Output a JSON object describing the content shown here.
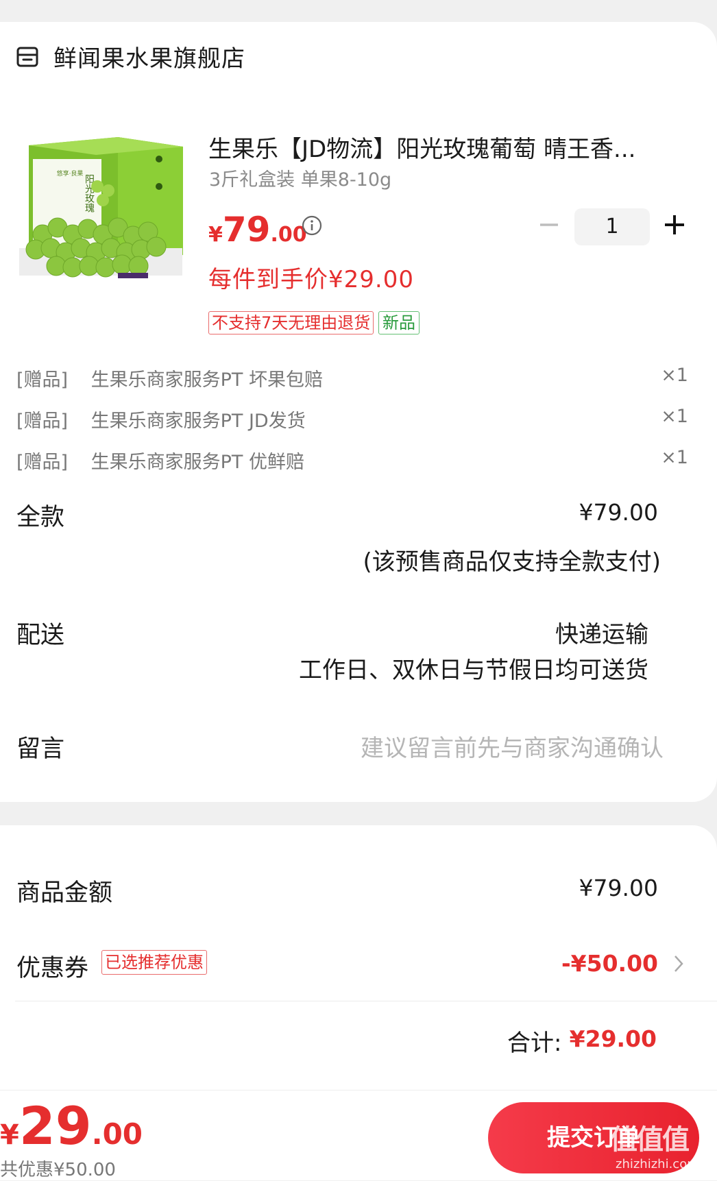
{
  "store": {
    "icon": "store-icon",
    "name": "鲜闻果水果旗舰店"
  },
  "product": {
    "title": "生果乐【JD物流】阳光玫瑰葡萄 晴王香...",
    "spec": "3斤礼盒装 单果8-10g",
    "price_yen": "¥",
    "price_int": "79",
    "price_dec": ".00",
    "arrive_price": "每件到手价¥29.00",
    "quantity": "1",
    "tags": [
      "不支持7天无理由退货",
      "新品"
    ],
    "image_box_text": "阳光玫瑰",
    "image_brand_text": "悠享·良果"
  },
  "gifts": [
    {
      "prefix": "[赠品]",
      "name": "生果乐商家服务PT 坏果包赔",
      "qty": "×1"
    },
    {
      "prefix": "[赠品]",
      "name": "生果乐商家服务PT JD发货",
      "qty": "×1"
    },
    {
      "prefix": "[赠品]",
      "name": "生果乐商家服务PT 优鲜赔",
      "qty": "×1"
    }
  ],
  "payment": {
    "label": "全款",
    "value": "¥79.00",
    "note": "(该预售商品仅支持全款支付)"
  },
  "delivery": {
    "label": "配送",
    "method": "快递运输",
    "detail": "工作日、双休日与节假日均可送货"
  },
  "message": {
    "label": "留言",
    "placeholder": "建议留言前先与商家沟通确认"
  },
  "summary": {
    "goods_label": "商品金额",
    "goods_value": "¥79.00",
    "coupon_label": "优惠券",
    "coupon_tag": "已选推荐优惠",
    "coupon_value": "-¥50.00",
    "total_label": "合计:",
    "total_value": "¥29.00"
  },
  "bottom": {
    "price_yen": "¥",
    "price_int": "29",
    "price_dec": ".00",
    "discount_text": "共优惠¥50.00",
    "submit_label": "提交订单"
  },
  "watermark": {
    "main": "值值值",
    "sub": "zhizhizhi.com"
  },
  "colors": {
    "accent": "#e52e2e",
    "green": "#2a9b3d",
    "submit": "#f03341"
  }
}
